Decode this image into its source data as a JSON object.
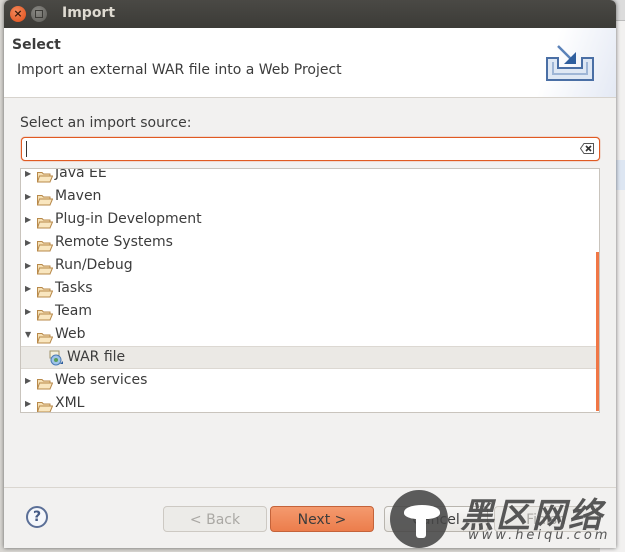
{
  "window": {
    "title": "Import",
    "close_glyph": "×"
  },
  "banner": {
    "heading": "Select",
    "description": "Import an external WAR file into a Web Project",
    "icon": "import-wizard-icon"
  },
  "source": {
    "label": "Select an import source:",
    "filter_value": "",
    "filter_placeholder": "",
    "clear_icon": "clear-text-icon"
  },
  "tree": {
    "items": [
      {
        "label": "Java EE",
        "expanded": false,
        "type": "folder"
      },
      {
        "label": "Maven",
        "expanded": false,
        "type": "folder"
      },
      {
        "label": "Plug-in Development",
        "expanded": false,
        "type": "folder"
      },
      {
        "label": "Remote Systems",
        "expanded": false,
        "type": "folder"
      },
      {
        "label": "Run/Debug",
        "expanded": false,
        "type": "folder"
      },
      {
        "label": "Tasks",
        "expanded": false,
        "type": "folder"
      },
      {
        "label": "Team",
        "expanded": false,
        "type": "folder"
      },
      {
        "label": "Web",
        "expanded": true,
        "type": "folder"
      },
      {
        "label": "WAR file",
        "type": "wizard",
        "selected": true
      },
      {
        "label": "Web services",
        "expanded": false,
        "type": "folder"
      },
      {
        "label": "XML",
        "expanded": false,
        "type": "folder"
      }
    ],
    "expander_collapsed": "▶",
    "expander_expanded": "▼"
  },
  "buttons": {
    "help": "?",
    "back": "< Back",
    "next": "Next >",
    "cancel": "Cancel",
    "finish": "Finish"
  },
  "watermark": {
    "text": "黑区网络",
    "url": "www.heiqu.com"
  },
  "colors": {
    "accent": "#e05a22",
    "primary_button": "#ec7d4c",
    "titlebar": "#3c3b37"
  }
}
